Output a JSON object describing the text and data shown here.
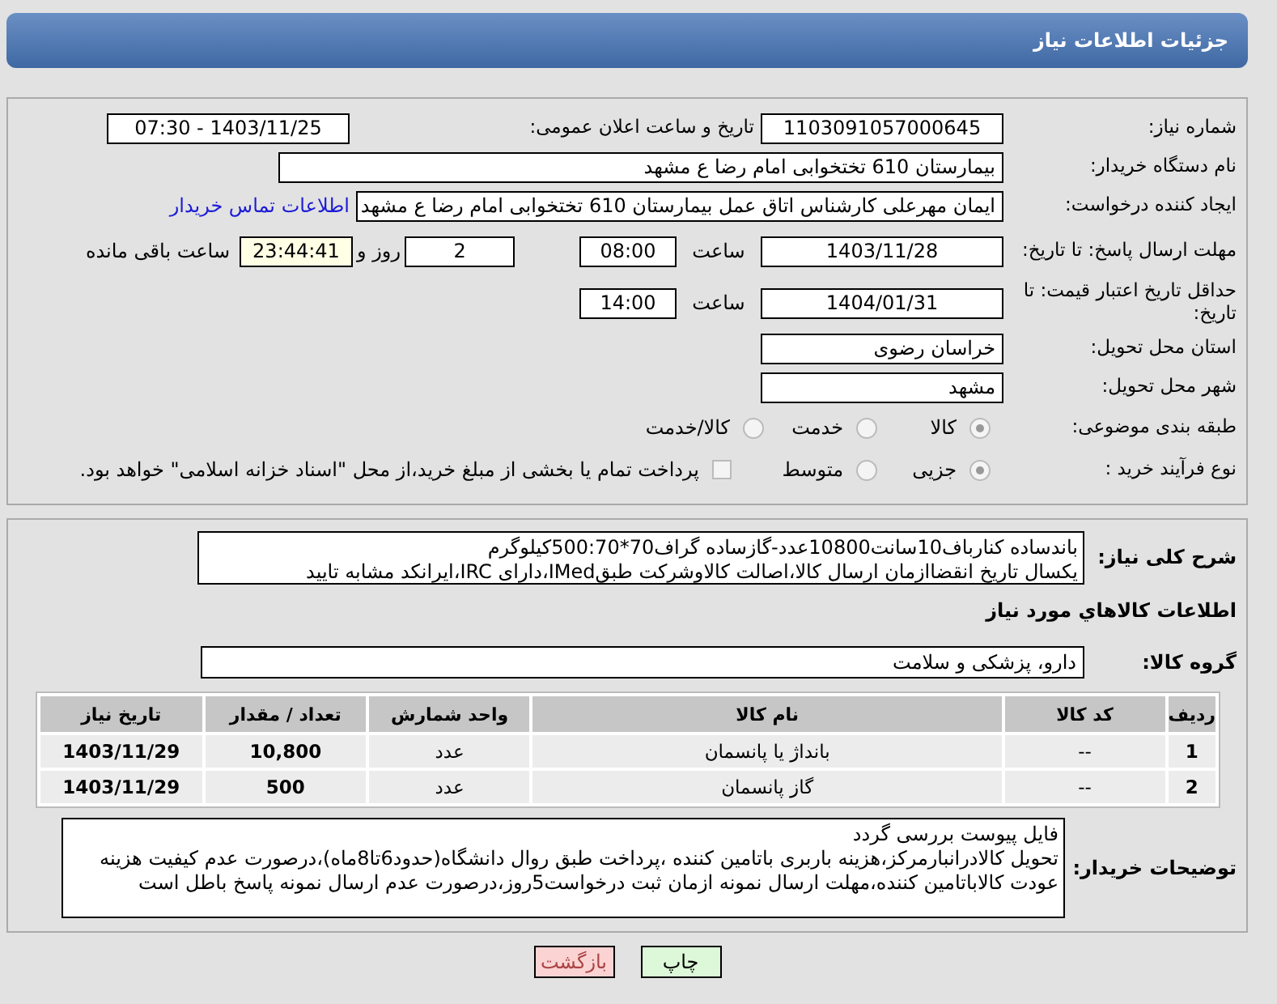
{
  "header": {
    "title": "جزئیات اطلاعات نیاز"
  },
  "need_number": {
    "label": "شماره نیاز:",
    "value": "1103091057000645"
  },
  "announce": {
    "label": "تاریخ و ساعت اعلان عمومی:",
    "value": "1403/11/25 - 07:30"
  },
  "buyer": {
    "label": "نام دستگاه خریدار:",
    "value": "بیمارستان 610 تختخوابی امام رضا ع  مشهد"
  },
  "creator": {
    "label": "ایجاد کننده درخواست:",
    "value": "ایمان مهرعلی کارشناس اتاق عمل بیمارستان 610 تختخوابی امام رضا ع  مشهد",
    "link": "اطلاعات تماس خریدار"
  },
  "deadline": {
    "label": "مهلت ارسال پاسخ: تا تاریخ:",
    "date": "1403/11/28",
    "time_label": "ساعت",
    "time": "08:00",
    "days": "2",
    "days_label": "روز و",
    "remaining": "23:44:41",
    "remaining_label": "ساعت باقی مانده"
  },
  "validity": {
    "label": "حداقل تاریخ اعتبار قیمت: تا تاریخ:",
    "date": "1404/01/31",
    "time_label": "ساعت",
    "time": "14:00"
  },
  "province": {
    "label": "استان محل تحویل:",
    "value": "خراسان رضوی"
  },
  "city": {
    "label": "شهر محل تحویل:",
    "value": "مشهد"
  },
  "category": {
    "label": "طبقه بندی موضوعی:",
    "options": [
      {
        "label": "کالا",
        "selected": true
      },
      {
        "label": "خدمت",
        "selected": false
      },
      {
        "label": "کالا/خدمت",
        "selected": false
      }
    ]
  },
  "purchase_type": {
    "label": "نوع فرآیند خرید :",
    "options": [
      {
        "label": "جزیی",
        "selected": true
      },
      {
        "label": "متوسط",
        "selected": false
      }
    ],
    "payment_checkbox": {
      "checked": false,
      "label": "پرداخت تمام یا بخشی از مبلغ خرید،از محل \"اسناد خزانه اسلامی\" خواهد بود."
    }
  },
  "description": {
    "label": "شرح کلی نیاز:",
    "lines": [
      "باندساده کنارباف10سانت10800عدد-گازساده گراف70*500:70کیلوگرم",
      "یکسال تاریخ انقضاازمان ارسال کالا،اصالت کالاوشرکت طبقIMed،دارای IRC،ایرانکد مشابه تایید"
    ]
  },
  "goods_heading": "اطلاعات کالاهاي مورد نياز",
  "goods_group": {
    "label": "گروه کالا:",
    "value": "دارو، پزشکی و سلامت"
  },
  "table": {
    "columns": [
      "ردیف",
      "کد کالا",
      "نام کالا",
      "واحد شمارش",
      "تعداد / مقدار",
      "تاریخ نیاز"
    ],
    "rows": [
      [
        "1",
        "--",
        "بانداژ یا پانسمان",
        "عدد",
        "10,800",
        "1403/11/29"
      ],
      [
        "2",
        "--",
        "گاز پانسمان",
        "عدد",
        "500",
        "1403/11/29"
      ]
    ]
  },
  "notes": {
    "label": "توضیحات خریدار:",
    "lines": [
      "فایل پیوست بررسی گردد",
      "تحویل کالادرانبارمرکز،هزینه باربری باتامین کننده ،پرداخت طبق روال دانشگاه(حدود6تا8ماه)،درصورت عدم کیفیت هزینه عودت کالاباتامین کننده،مهلت ارسال نمونه ازمان ثبت درخواست5روز،درصورت عدم ارسال نمونه پاسخ باطل است"
    ]
  },
  "buttons": [
    {
      "label": "چاپ",
      "kind": "print"
    },
    {
      "label": "بازگشت",
      "kind": "back"
    }
  ]
}
